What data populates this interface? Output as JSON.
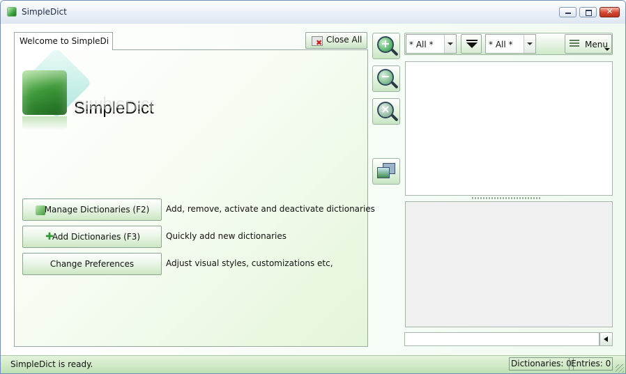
{
  "window": {
    "title": "SimpleDict"
  },
  "tabs": [
    {
      "label": "Welcome to SimpleDict"
    }
  ],
  "toolbar": {
    "close_all_label": "Close All"
  },
  "logo": {
    "text": "SimpleDict"
  },
  "actions": [
    {
      "label": "Manage Dictionaries (F2)",
      "description": "Add, remove, activate and deactivate dictionaries"
    },
    {
      "label": "Add Dictionaries (F3)",
      "description": "Quickly add new dictionaries"
    },
    {
      "label": "Change Preferences",
      "description": "Adjust visual styles, customizations etc,"
    }
  ],
  "side_tools": [
    {
      "name": "zoom-in",
      "icon": "zoom-in-icon"
    },
    {
      "name": "zoom-out",
      "icon": "zoom-out-icon"
    },
    {
      "name": "zoom-reset",
      "icon": "zoom-reset-icon"
    },
    {
      "name": "windows",
      "icon": "stacked-windows-icon"
    }
  ],
  "filters": {
    "language_from": "* All *",
    "language_to": "* All *",
    "menu_label": "Menu"
  },
  "search": {
    "value": "",
    "placeholder": ""
  },
  "status": {
    "message": "SimpleDict is ready.",
    "dictionaries": "Dictionaries: 0",
    "entries": "Entries: 0"
  },
  "colors": {
    "accent_green": "#3f9a3b",
    "panel_tint": "#e4f6da",
    "status_bar": "#bfe0b3"
  }
}
